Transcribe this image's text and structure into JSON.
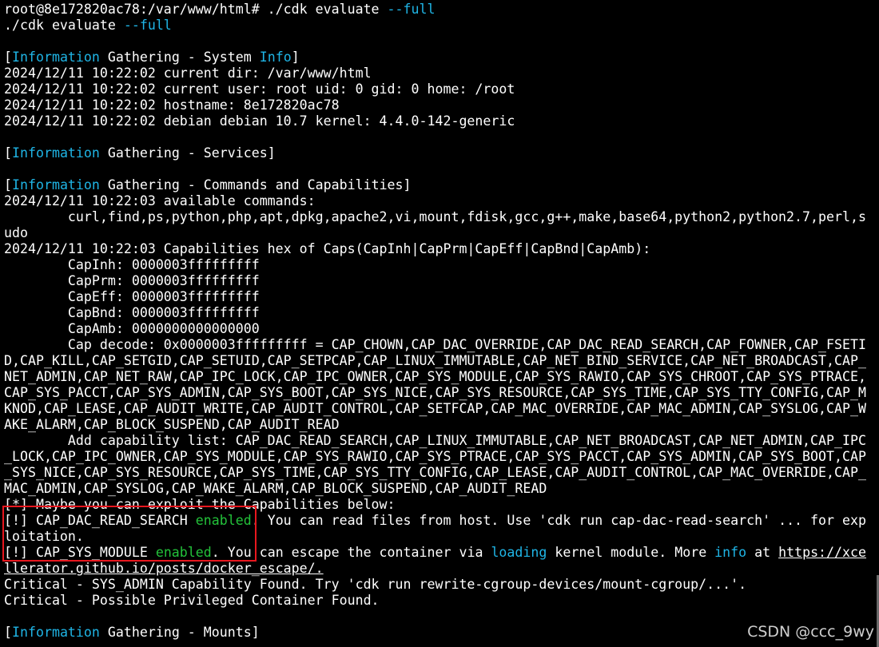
{
  "watermark": "CSDN @ccc_9wy",
  "annotation": {
    "color": "#e8171e"
  },
  "colors": {
    "background": "#000000",
    "text": "#ffffff",
    "cyan": "#1fb5e6",
    "green": "#23c23a"
  },
  "lines": [
    [
      {
        "t": "root@8e172820ac78:/var/www/html# ./cdk evaluate "
      },
      {
        "t": "--full",
        "s": "c"
      }
    ],
    [
      {
        "t": "./cdk evaluate "
      },
      {
        "t": "--full",
        "s": "c"
      }
    ],
    [
      {
        "t": ""
      }
    ],
    [
      {
        "t": "["
      },
      {
        "t": "Information",
        "s": "c"
      },
      {
        "t": " Gathering - System "
      },
      {
        "t": "Info",
        "s": "c"
      },
      {
        "t": "]"
      }
    ],
    [
      {
        "t": "2024/12/11 10:22:02 current dir: /var/www/html"
      }
    ],
    [
      {
        "t": "2024/12/11 10:22:02 current user: root uid: 0 gid: 0 home: /root"
      }
    ],
    [
      {
        "t": "2024/12/11 10:22:02 hostname: 8e172820ac78"
      }
    ],
    [
      {
        "t": "2024/12/11 10:22:02 debian debian 10.7 kernel: 4.4.0-142-generic"
      }
    ],
    [
      {
        "t": ""
      }
    ],
    [
      {
        "t": "["
      },
      {
        "t": "Information",
        "s": "c"
      },
      {
        "t": " Gathering - Services]"
      }
    ],
    [
      {
        "t": ""
      }
    ],
    [
      {
        "t": "["
      },
      {
        "t": "Information",
        "s": "c"
      },
      {
        "t": " Gathering - Commands and Capabilities]"
      }
    ],
    [
      {
        "t": "2024/12/11 10:22:03 available commands:"
      }
    ],
    [
      {
        "t": "        curl,find,ps,python,php,apt,dpkg,apache2,vi,mount,fdisk,gcc,g++,make,base64,python2,python2.7,perl,s"
      }
    ],
    [
      {
        "t": "udo"
      }
    ],
    [
      {
        "t": "2024/12/11 10:22:03 Capabilities hex of Caps(CapInh|CapPrm|CapEff|CapBnd|CapAmb):"
      }
    ],
    [
      {
        "t": "        CapInh: 0000003fffffffff"
      }
    ],
    [
      {
        "t": "        CapPrm: 0000003fffffffff"
      }
    ],
    [
      {
        "t": "        CapEff: 0000003fffffffff"
      }
    ],
    [
      {
        "t": "        CapBnd: 0000003fffffffff"
      }
    ],
    [
      {
        "t": "        CapAmb: 0000000000000000"
      }
    ],
    [
      {
        "t": "        Cap decode: 0x0000003fffffffff = CAP_CHOWN,CAP_DAC_OVERRIDE,CAP_DAC_READ_SEARCH,CAP_FOWNER,CAP_FSETI"
      }
    ],
    [
      {
        "t": "D,CAP_KILL,CAP_SETGID,CAP_SETUID,CAP_SETPCAP,CAP_LINUX_IMMUTABLE,CAP_NET_BIND_SERVICE,CAP_NET_BROADCAST,CAP_"
      }
    ],
    [
      {
        "t": "NET_ADMIN,CAP_NET_RAW,CAP_IPC_LOCK,CAP_IPC_OWNER,CAP_SYS_MODULE,CAP_SYS_RAWIO,CAP_SYS_CHROOT,CAP_SYS_PTRACE,"
      }
    ],
    [
      {
        "t": "CAP_SYS_PACCT,CAP_SYS_ADMIN,CAP_SYS_BOOT,CAP_SYS_NICE,CAP_SYS_RESOURCE,CAP_SYS_TIME,CAP_SYS_TTY_CONFIG,CAP_M"
      }
    ],
    [
      {
        "t": "KNOD,CAP_LEASE,CAP_AUDIT_WRITE,CAP_AUDIT_CONTROL,CAP_SETFCAP,CAP_MAC_OVERRIDE,CAP_MAC_ADMIN,CAP_SYSLOG,CAP_W"
      }
    ],
    [
      {
        "t": "AKE_ALARM,CAP_BLOCK_SUSPEND,CAP_AUDIT_READ"
      }
    ],
    [
      {
        "t": "        Add capability list: CAP_DAC_READ_SEARCH,CAP_LINUX_IMMUTABLE,CAP_NET_BROADCAST,CAP_NET_ADMIN,CAP_IPC"
      }
    ],
    [
      {
        "t": "_LOCK,CAP_IPC_OWNER,CAP_SYS_MODULE,CAP_SYS_RAWIO,CAP_SYS_PTRACE,CAP_SYS_PACCT,CAP_SYS_ADMIN,CAP_SYS_BOOT,CAP"
      }
    ],
    [
      {
        "t": "_SYS_NICE,CAP_SYS_RESOURCE,CAP_SYS_TIME,CAP_SYS_TTY_CONFIG,CAP_LEASE,CAP_AUDIT_CONTROL,CAP_MAC_OVERRIDE,CAP_"
      }
    ],
    [
      {
        "t": "MAC_ADMIN,CAP_SYSLOG,CAP_WAKE_ALARM,CAP_BLOCK_SUSPEND,CAP_AUDIT_READ"
      }
    ],
    [
      {
        "t": "[*] Maybe you can exploit the Capabilities below:"
      }
    ],
    [
      {
        "t": "[!] CAP_DAC_READ_SEARCH "
      },
      {
        "t": "enabled",
        "s": "g"
      },
      {
        "t": ". You can read files from host. Use 'cdk run cap-dac-read-search' ... for exp"
      }
    ],
    [
      {
        "t": "loitation."
      }
    ],
    [
      {
        "t": "[!] CAP_SYS_MODULE "
      },
      {
        "t": "enabled",
        "s": "g"
      },
      {
        "t": ". You can escape the container via "
      },
      {
        "t": "loading",
        "s": "c"
      },
      {
        "t": " kernel module. More "
      },
      {
        "t": "info",
        "s": "c"
      },
      {
        "t": " at "
      },
      {
        "t": "https://xce",
        "s": "u"
      }
    ],
    [
      {
        "t": "llerator.github.io/posts/docker_escape/.",
        "s": "u"
      }
    ],
    [
      {
        "t": "Critical - SYS_ADMIN Capability Found. Try 'cdk run rewrite-cgroup-devices/mount-cgroup/...'."
      }
    ],
    [
      {
        "t": "Critical - Possible Privileged Container Found."
      }
    ],
    [
      {
        "t": ""
      }
    ],
    [
      {
        "t": "["
      },
      {
        "t": "Information",
        "s": "c"
      },
      {
        "t": " Gathering - Mounts]"
      }
    ]
  ]
}
